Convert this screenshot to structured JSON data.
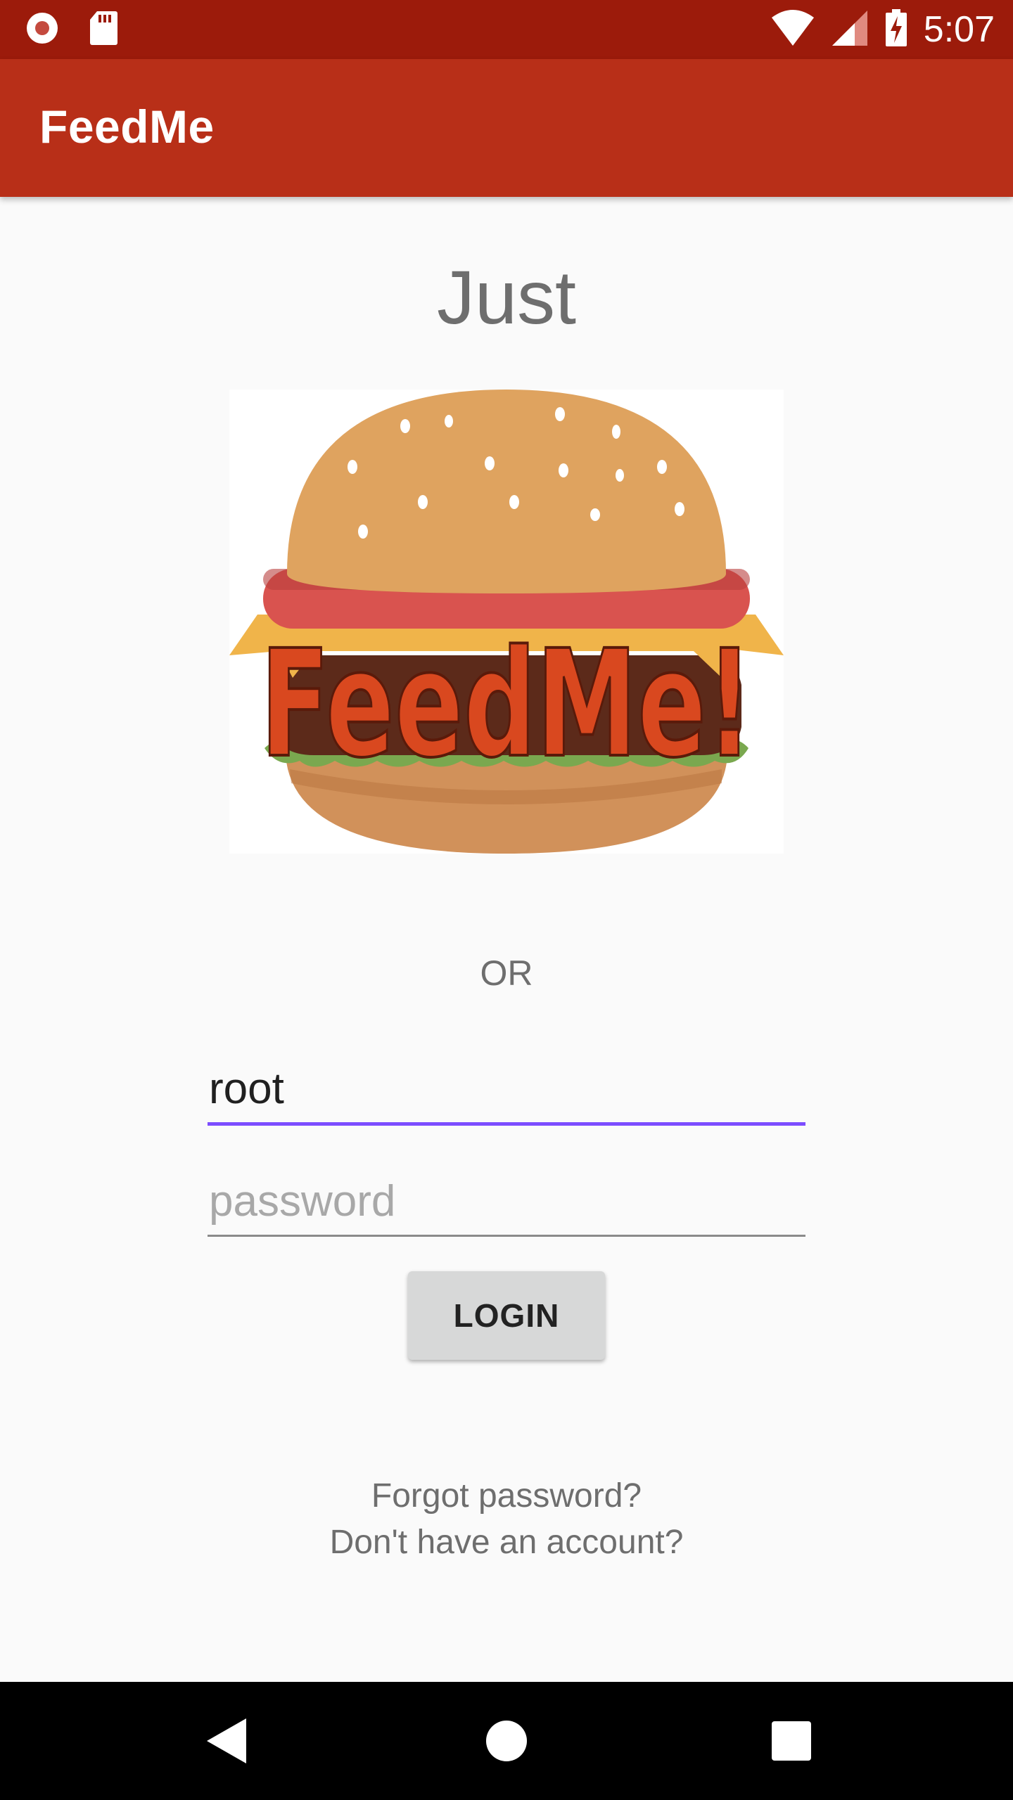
{
  "status_bar": {
    "time": "5:07",
    "icons": [
      "record-icon",
      "sd-card-icon",
      "wifi-icon",
      "signal-icon",
      "battery-charging-icon"
    ]
  },
  "app_bar": {
    "title": "FeedMe"
  },
  "hero": {
    "text": "Just"
  },
  "logo": {
    "text": "FeedMe!"
  },
  "divider": {
    "or": "OR"
  },
  "login_form": {
    "username_value": "root",
    "password_placeholder": "password",
    "login_label": "LOGIN"
  },
  "links": {
    "forgot": "Forgot password?",
    "signup": "Don't have an account?"
  },
  "colors": {
    "status_bar": "#9c1b0b",
    "app_bar": "#b82f18",
    "accent": "#7c4dff",
    "background": "#fafafa"
  },
  "nav": {
    "icons": [
      "back-icon",
      "home-icon",
      "recents-icon"
    ]
  }
}
